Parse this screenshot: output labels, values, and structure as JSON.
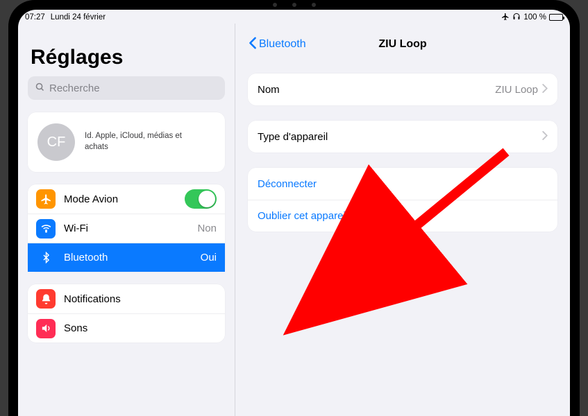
{
  "status": {
    "time": "07:27",
    "date": "Lundi 24 février",
    "battery_percent": "100 %"
  },
  "sidebar": {
    "title": "Réglages",
    "search_placeholder": "Recherche",
    "profile": {
      "initials": "CF",
      "subtitle": "Id. Apple, iCloud, médias et achats"
    },
    "group1": {
      "airplane": "Mode Avion",
      "wifi": {
        "label": "Wi-Fi",
        "value": "Non"
      },
      "bluetooth": {
        "label": "Bluetooth",
        "value": "Oui"
      }
    },
    "group2": {
      "notifications": "Notifications",
      "sounds": "Sons"
    }
  },
  "detail": {
    "back": "Bluetooth",
    "title": "ZIU Loop",
    "name_row": {
      "label": "Nom",
      "value": "ZIU Loop"
    },
    "type_row": {
      "label": "Type d'appareil"
    },
    "actions": {
      "disconnect": "Déconnecter",
      "forget": "Oublier cet appareil"
    }
  }
}
